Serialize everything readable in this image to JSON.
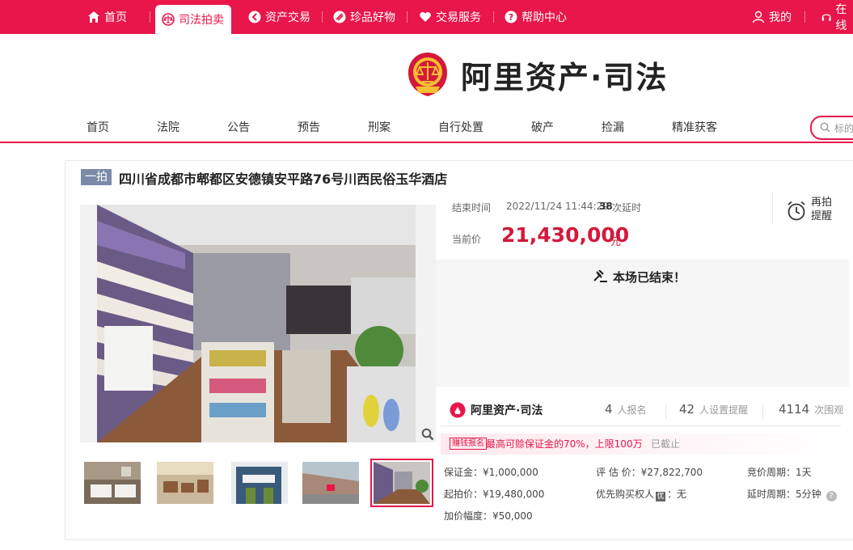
{
  "topbar": {
    "items": [
      {
        "label": "首页",
        "icon": "home-icon"
      },
      {
        "label": "司法拍卖",
        "icon": "court-emblem-icon"
      },
      {
        "label": "资产交易",
        "icon": "asset-icon"
      },
      {
        "label": "珍品好物",
        "icon": "treasure-icon"
      },
      {
        "label": "交易服务",
        "icon": "heart-icon"
      },
      {
        "label": "帮助中心",
        "icon": "help-icon"
      }
    ],
    "mine": "我的",
    "online": "在线"
  },
  "brand": {
    "logo_text": "阿里资产·司法",
    "small_logo_text": "阿里资产·司法"
  },
  "main_nav": [
    "首页",
    "法院",
    "公告",
    "预告",
    "刑案",
    "自行处置",
    "破产",
    "捡漏",
    "精准获客"
  ],
  "search": {
    "placeholder": "标的"
  },
  "item": {
    "tag": "一拍",
    "title": "四川省成都市郫都区安德镇安平路76号川西民俗玉华酒店",
    "end_label": "结束时间",
    "end_time": "2022/11/24 11:44:29",
    "delays_count": "38",
    "delays_label": "次延时",
    "current_price_label": "当前价",
    "current_price": "21,430,000",
    "price_unit": "元",
    "remind_line1": "再拍",
    "remind_line2": "提醒",
    "ended_text": "本场已结束！"
  },
  "stats": {
    "signups": "4",
    "signups_label": "人报名",
    "reminders": "42",
    "reminders_label": "人设置提醒",
    "views": "4114",
    "views_label": "次围观"
  },
  "promo": {
    "badge": "赚钱报名",
    "text": "最高可赊保证金的70%，上限100万",
    "status": "已截止"
  },
  "details": {
    "deposit": "保证金：¥1,000,000",
    "appraisal": "评 估 价：¥27,822,700",
    "cycle": "竞价周期：1天",
    "start_price": "起拍价：¥19,480,000",
    "priority_label": "优先购买权人",
    "priority_badge": "优",
    "priority_value": "：无",
    "delay_cycle": "延时周期：5分钟",
    "increment": "加价幅度：¥50,000"
  },
  "colors": {
    "brand_red": "#e8164a",
    "price_red": "#d4183b",
    "tag_gray": "#7b8aa8"
  }
}
